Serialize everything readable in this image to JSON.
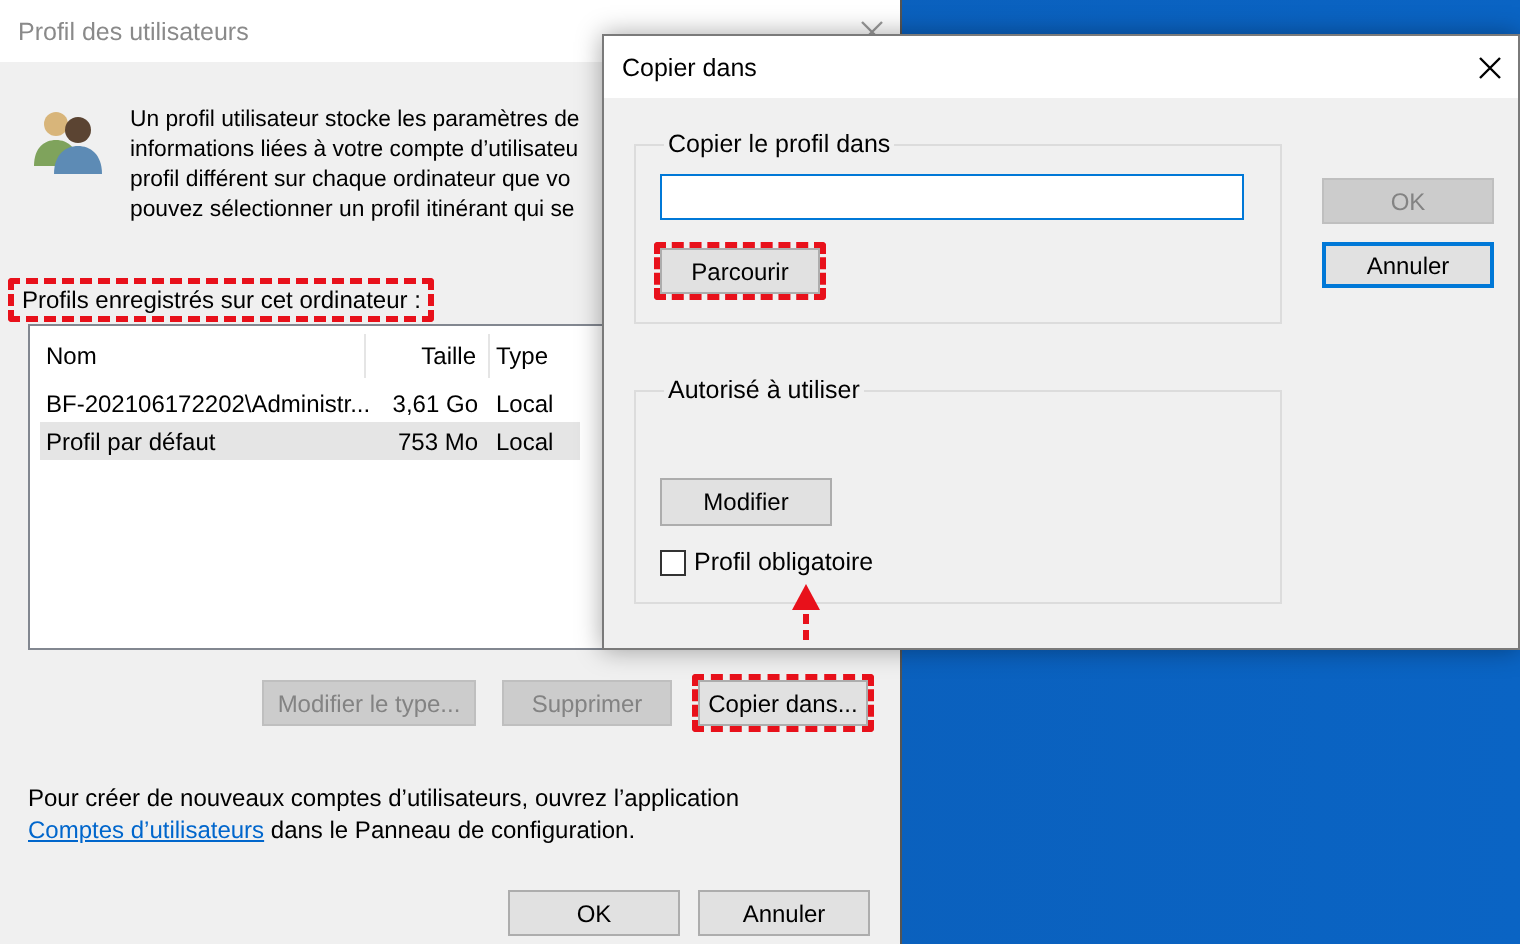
{
  "main_window": {
    "title": "Profil des utilisateurs",
    "intro_lines": [
      "Un profil utilisateur stocke les paramètres de",
      "informations liées à votre compte d’utilisateu",
      "profil différent sur chaque ordinateur que vo",
      "pouvez sélectionner un profil itinérant qui se"
    ],
    "profiles_label": {
      "text": "Profils enregistrés sur cet ordinateur :",
      "highlighted": true
    },
    "table": {
      "columns": [
        "Nom",
        "Taille",
        "Type"
      ],
      "rows": [
        {
          "cells": [
            "BF-202106172202\\Administr...",
            "3,61 Go",
            "Local"
          ],
          "selected": false
        },
        {
          "cells": [
            "Profil par défaut",
            "753 Mo",
            "Local"
          ],
          "selected": true
        }
      ]
    },
    "actions": [
      {
        "label": "Modifier le type...",
        "disabled": true,
        "highlighted": false
      },
      {
        "label": "Supprimer",
        "disabled": true,
        "highlighted": false
      },
      {
        "label": "Copier dans...",
        "disabled": false,
        "highlighted": true
      }
    ],
    "footer": {
      "text": "Pour créer de nouveaux comptes d’utilisateurs, ouvrez l’application",
      "link": "Comptes d’utilisateurs",
      "after": "dans le Panneau de configuration."
    },
    "buttons": [
      {
        "label": "OK",
        "default": false
      },
      {
        "label": "Annuler",
        "default": false
      }
    ]
  },
  "copy_dialog": {
    "title": "Copier dans",
    "copy_group": {
      "legend": "Copier le profil dans",
      "field_focused": true,
      "browse": {
        "label": "Parcourir",
        "highlighted": true
      }
    },
    "allowed_group": {
      "legend": "Autorisé à utiliser",
      "change": {
        "label": "Modifier"
      },
      "mandatory": {
        "label": "Profil obligatoire",
        "checked": false
      }
    },
    "buttons": [
      {
        "label": "OK",
        "disabled": true,
        "default": false
      },
      {
        "label": "Annuler",
        "disabled": false,
        "default": true
      }
    ]
  }
}
